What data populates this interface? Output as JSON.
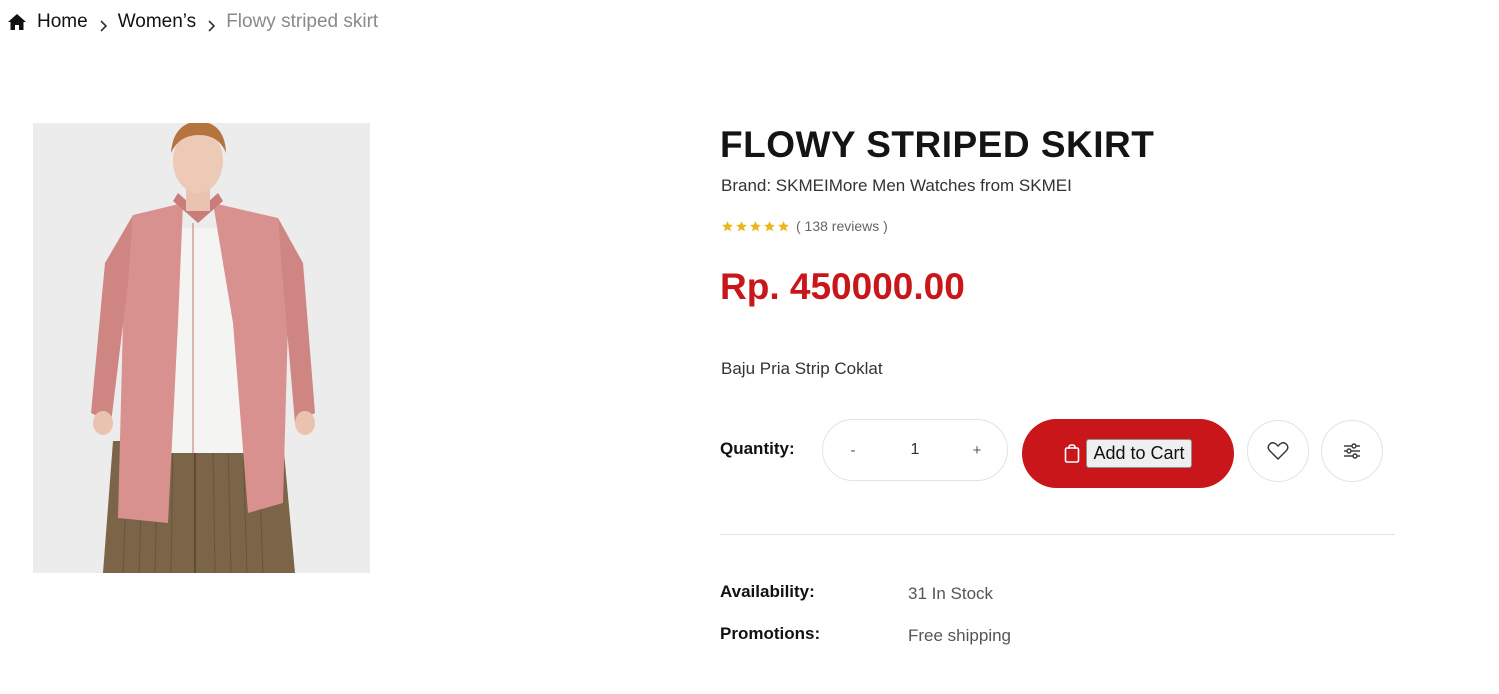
{
  "breadcrumb": {
    "home": "Home",
    "category": "Women’s",
    "current": "Flowy striped skirt"
  },
  "product": {
    "title": "FLOWY STRIPED SKIRT",
    "brand_line": "Brand: SKMEIMore Men Watches from SKMEI",
    "rating": {
      "stars": 5,
      "reviews_text": "( 138 reviews )"
    },
    "price": "Rp. 450000.00",
    "description": "Baju Pria Strip Coklat"
  },
  "purchase": {
    "quantity_label": "Quantity:",
    "decrement": "-",
    "quantity": "1",
    "increment": "+",
    "add_to_cart": "Add to Cart"
  },
  "meta": {
    "availability_label": "Availability:",
    "availability_value": "31 In Stock",
    "promotions_label": "Promotions:",
    "promotions_value": "Free shipping"
  },
  "colors": {
    "accent": "#c8161b",
    "star": "#e8b81c"
  },
  "icons": {
    "home": "home-icon",
    "chevron": "chevron-right-icon",
    "bag": "shopping-bag-icon",
    "wishlist": "heart-icon",
    "compare": "sliders-icon"
  }
}
